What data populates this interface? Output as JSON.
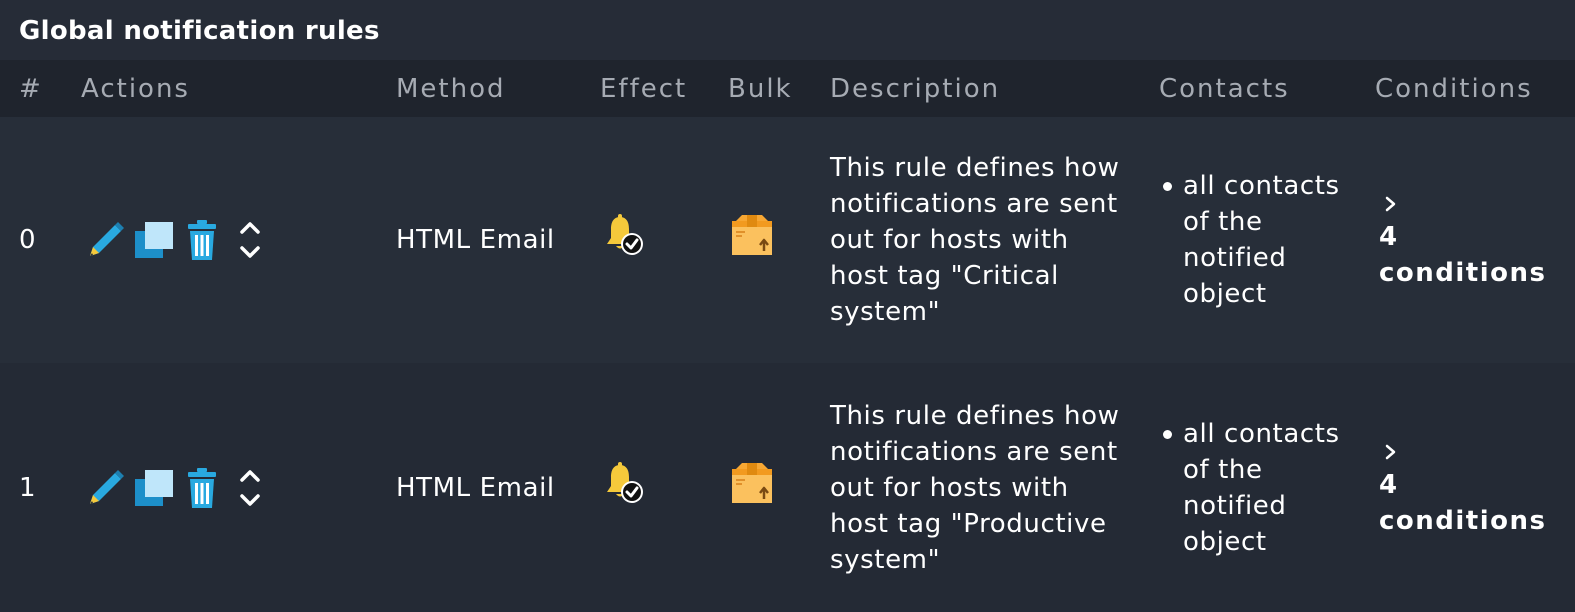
{
  "panel": {
    "title": "Global notification rules"
  },
  "table": {
    "headers": {
      "num": "#",
      "actions": "Actions",
      "method": "Method",
      "effect": "Effect",
      "bulk": "Bulk",
      "description": "Description",
      "contacts": "Contacts",
      "conditions": "Conditions"
    },
    "rows": [
      {
        "num": "0",
        "actions": [
          "edit-icon",
          "clone-icon",
          "delete-icon",
          "move-icon"
        ],
        "method": "HTML Email",
        "effect_icon": "bell-check-icon",
        "bulk_icon": "box-icon",
        "description": "This rule defines how notifications are sent out for hosts with host tag \"Critical system\"",
        "contacts": [
          "all contacts of the notified object"
        ],
        "conditions_count": "4",
        "conditions_label": "conditions"
      },
      {
        "num": "1",
        "actions": [
          "edit-icon",
          "clone-icon",
          "delete-icon",
          "move-icon"
        ],
        "method": "HTML Email",
        "effect_icon": "bell-check-icon",
        "bulk_icon": "box-icon",
        "description": "This rule defines how notifications are sent out for hosts with host tag \"Productive system\"",
        "contacts": [
          "all contacts of the notified object"
        ],
        "conditions_count": "4",
        "conditions_label": "conditions"
      }
    ]
  },
  "colors": {
    "background": "#242a35",
    "header_background": "#1f242d",
    "header_text": "#a6abb3",
    "accent_blue": "#29a9e0",
    "bell_yellow": "#f5c93b",
    "box_orange": "#f7a733"
  }
}
